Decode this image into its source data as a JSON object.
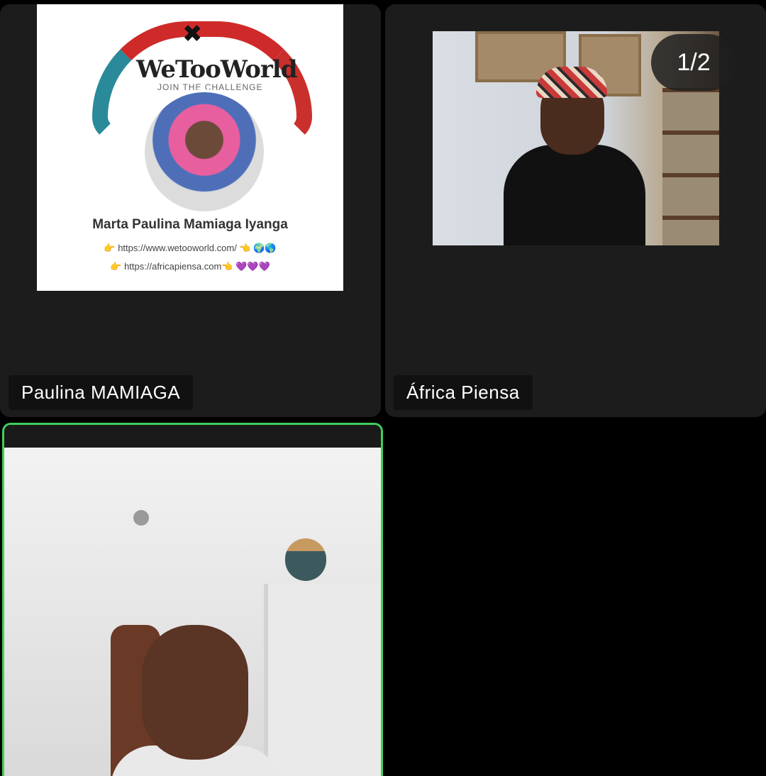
{
  "page_counter": "1/2",
  "tiles": [
    {
      "name": "Paulina MAMIAGA",
      "card": {
        "brand": "WeTooWorld",
        "brand_subtitle": "JOIN THE CHALLENGE",
        "person_name": "Marta Paulina Mamiaga Iyanga",
        "link1": "👉 https://www.wetooworld.com/ 👈 🌍🌎",
        "link2": "👉 https://africapiensa.com👈 💜💜💜"
      }
    },
    {
      "name": "África Piensa"
    },
    {
      "name": "",
      "active_speaker": true,
      "highlight_color": "#3ecf5e"
    }
  ]
}
